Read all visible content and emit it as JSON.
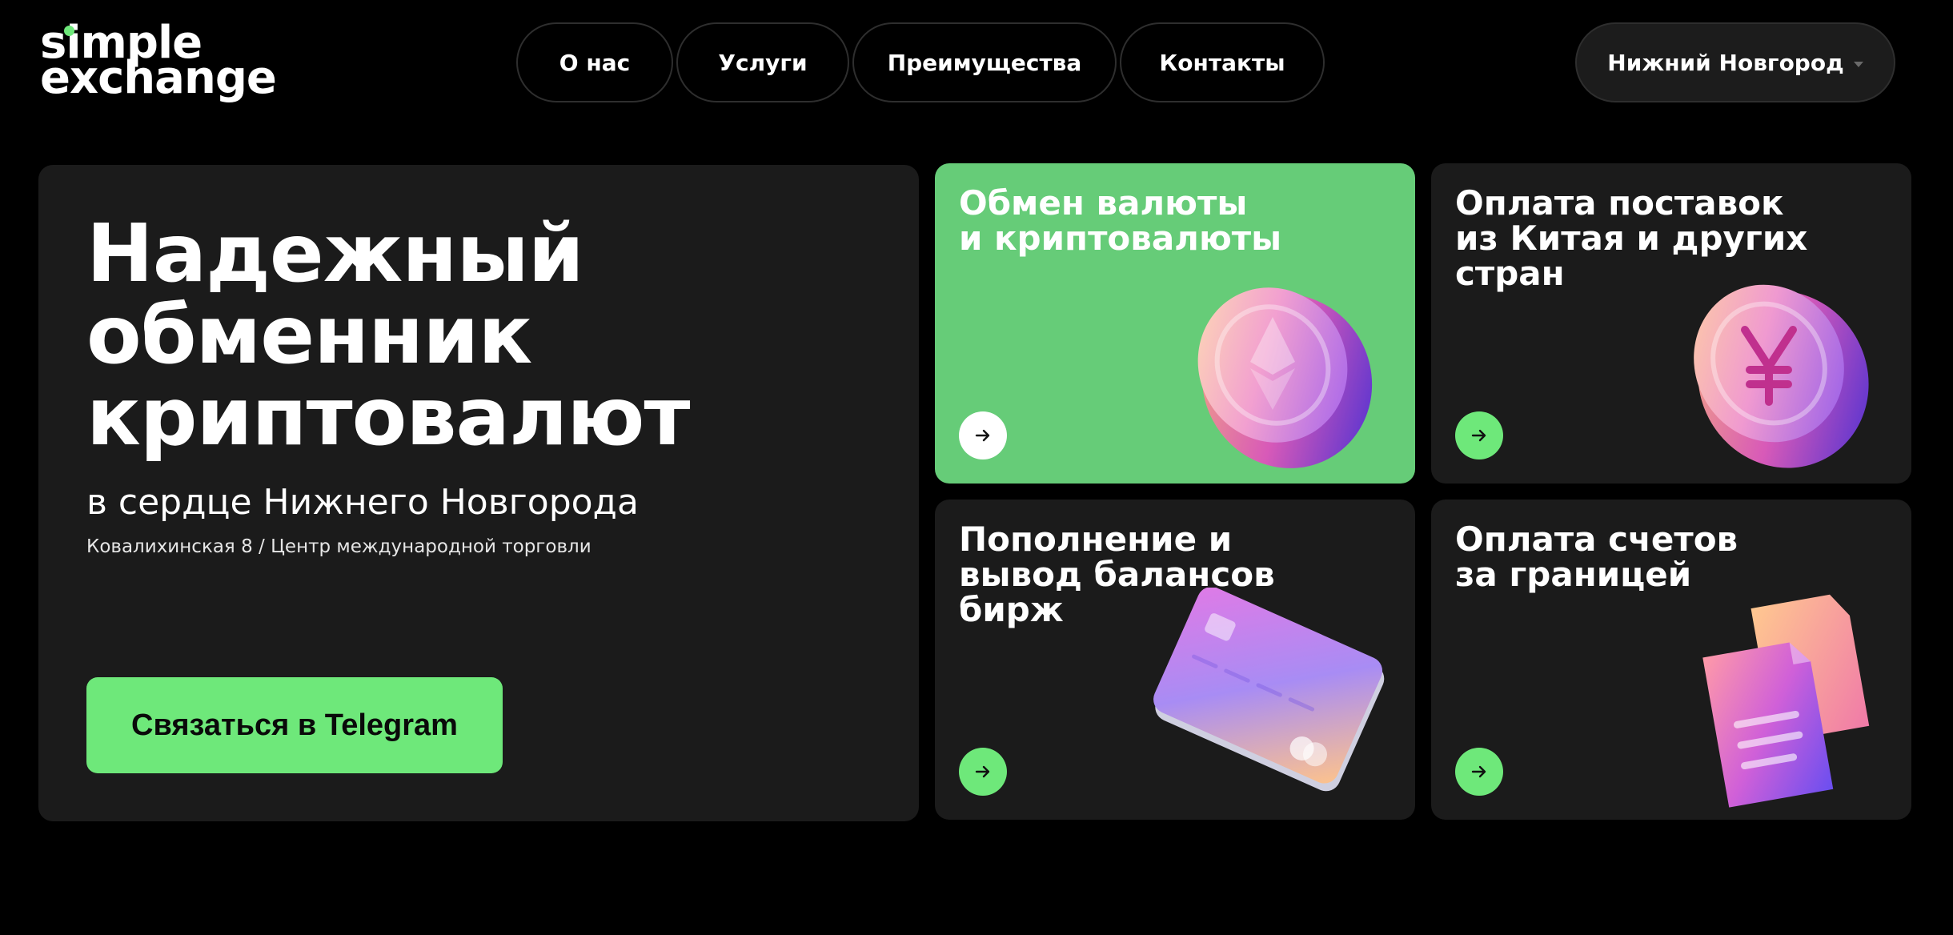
{
  "header": {
    "logo_line1": "simple",
    "logo_line2": "exchange",
    "nav": [
      {
        "label": "О нас"
      },
      {
        "label": "Услуги"
      },
      {
        "label": "Преимущества"
      },
      {
        "label": "Контакты"
      }
    ],
    "city": "Нижний Новгород"
  },
  "hero": {
    "title": "Надежный\nобменник\nкриптовалют",
    "subtitle": "в сердце Нижнего Новгорода",
    "address": "Ковалихинская 8 / Центр международной торговли",
    "cta_label": "Связаться в Telegram"
  },
  "services": [
    {
      "title": "Обмен валюты\nи криптовалюты",
      "icon": "ethereum-coin-icon"
    },
    {
      "title": "Оплата поставок\nиз Китая и других\nстран",
      "icon": "yuan-coin-icon"
    },
    {
      "title": "Пополнение и\nвывод балансов\nбирж",
      "icon": "bank-card-icon"
    },
    {
      "title": "Оплата счетов\nза границей",
      "icon": "invoice-documents-icon"
    }
  ],
  "colors": {
    "background": "#000000",
    "card": "#1b1b1b",
    "accent_green": "#6ee87a",
    "featured_card_green": "#66cc78"
  }
}
